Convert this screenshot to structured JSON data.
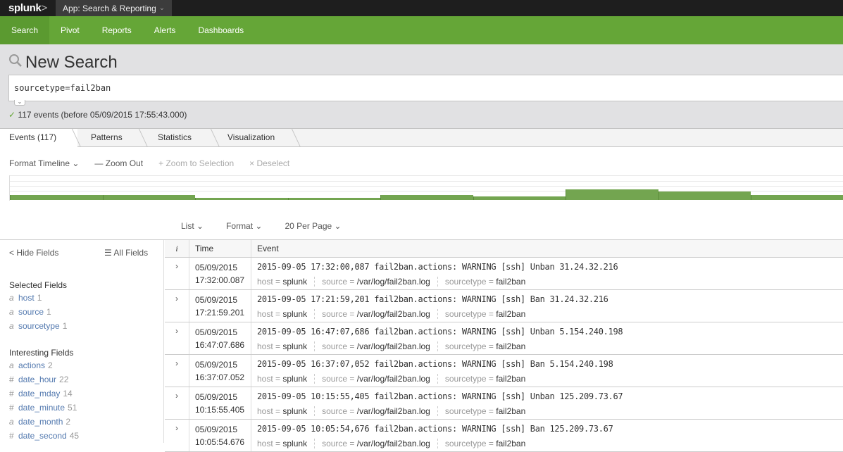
{
  "topbar": {
    "logo": "splunk",
    "logo_chevron": ">",
    "app": "App: Search & Reporting",
    "app_chevron": "⌄"
  },
  "nav": [
    {
      "label": "Search",
      "active": true
    },
    {
      "label": "Pivot"
    },
    {
      "label": "Reports"
    },
    {
      "label": "Alerts"
    },
    {
      "label": "Dashboards"
    }
  ],
  "search": {
    "title": "New Search",
    "query": "sourcetype=fail2ban",
    "status_check": "✓",
    "status": "117 events (before 05/09/2015 17:55:43.000)"
  },
  "tabs": [
    "Events (117)",
    "Patterns",
    "Statistics",
    "Visualization"
  ],
  "timeline_tools": {
    "format": "Format Timeline ⌄",
    "zoom_out": "— Zoom Out",
    "zoom_sel": "+ Zoom to Selection",
    "deselect": "× Deselect"
  },
  "timeline": {
    "bars": [
      6,
      6,
      3,
      3,
      6,
      4,
      13,
      10,
      6
    ],
    "max": 30
  },
  "list_options": {
    "list": "List ⌄",
    "format": "Format ⌄",
    "per_page": "20 Per Page ⌄"
  },
  "sidebar": {
    "hide": "< Hide Fields",
    "all": "☰ All Fields",
    "selected_title": "Selected Fields",
    "selected": [
      {
        "type": "a",
        "name": "host",
        "count": "1"
      },
      {
        "type": "a",
        "name": "source",
        "count": "1"
      },
      {
        "type": "a",
        "name": "sourcetype",
        "count": "1"
      }
    ],
    "interesting_title": "Interesting Fields",
    "interesting": [
      {
        "type": "a",
        "name": "actions",
        "count": "2"
      },
      {
        "type": "#",
        "name": "date_hour",
        "count": "22"
      },
      {
        "type": "#",
        "name": "date_mday",
        "count": "14"
      },
      {
        "type": "#",
        "name": "date_minute",
        "count": "51"
      },
      {
        "type": "a",
        "name": "date_month",
        "count": "2"
      },
      {
        "type": "#",
        "name": "date_second",
        "count": "45"
      }
    ]
  },
  "table": {
    "headers": [
      "i",
      "Time",
      "Event"
    ],
    "meta_labels": {
      "host": "host =",
      "source": "source =",
      "sourcetype": "sourcetype ="
    },
    "rows": [
      {
        "date": "05/09/2015",
        "time": "17:32:00.087",
        "raw": "2015-09-05 17:32:00,087 fail2ban.actions: WARNING [ssh] Unban 31.24.32.216",
        "host": "splunk",
        "source": "/var/log/fail2ban.log",
        "sourcetype": "fail2ban"
      },
      {
        "date": "05/09/2015",
        "time": "17:21:59.201",
        "raw": "2015-09-05 17:21:59,201 fail2ban.actions: WARNING [ssh] Ban 31.24.32.216",
        "host": "splunk",
        "source": "/var/log/fail2ban.log",
        "sourcetype": "fail2ban"
      },
      {
        "date": "05/09/2015",
        "time": "16:47:07.686",
        "raw": "2015-09-05 16:47:07,686 fail2ban.actions: WARNING [ssh] Unban 5.154.240.198",
        "host": "splunk",
        "source": "/var/log/fail2ban.log",
        "sourcetype": "fail2ban"
      },
      {
        "date": "05/09/2015",
        "time": "16:37:07.052",
        "raw": "2015-09-05 16:37:07,052 fail2ban.actions: WARNING [ssh] Ban 5.154.240.198",
        "host": "splunk",
        "source": "/var/log/fail2ban.log",
        "sourcetype": "fail2ban"
      },
      {
        "date": "05/09/2015",
        "time": "10:15:55.405",
        "raw": "2015-09-05 10:15:55,405 fail2ban.actions: WARNING [ssh] Unban 125.209.73.67",
        "host": "splunk",
        "source": "/var/log/fail2ban.log",
        "sourcetype": "fail2ban"
      },
      {
        "date": "05/09/2015",
        "time": "10:05:54.676",
        "raw": "2015-09-05 10:05:54,676 fail2ban.actions: WARNING [ssh] Ban 125.209.73.67",
        "host": "splunk",
        "source": "/var/log/fail2ban.log",
        "sourcetype": "fail2ban"
      }
    ]
  }
}
